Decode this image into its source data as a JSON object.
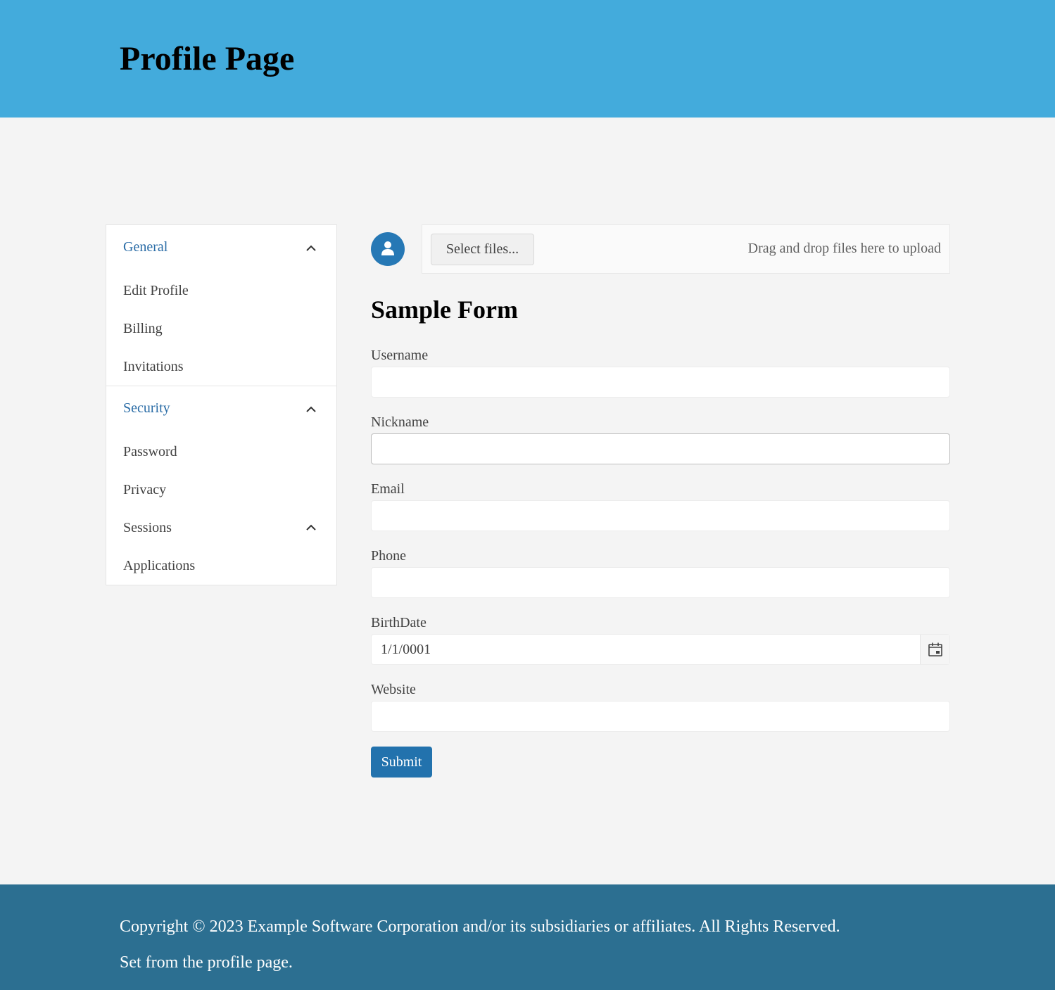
{
  "header": {
    "title": "Profile Page"
  },
  "sidebar": {
    "groups": [
      {
        "label": "General",
        "expanded": true,
        "items": [
          {
            "label": "Edit Profile"
          },
          {
            "label": "Billing"
          },
          {
            "label": "Invitations"
          }
        ]
      },
      {
        "label": "Security",
        "expanded": true,
        "items": [
          {
            "label": "Password"
          },
          {
            "label": "Privacy"
          },
          {
            "label": "Sessions",
            "expandable": true
          },
          {
            "label": "Applications"
          }
        ]
      }
    ]
  },
  "upload": {
    "button_label": "Select files...",
    "hint": "Drag and drop files here to upload",
    "avatar_icon": "user-icon"
  },
  "form": {
    "title": "Sample Form",
    "fields": [
      {
        "label": "Username",
        "value": ""
      },
      {
        "label": "Nickname",
        "value": ""
      },
      {
        "label": "Email",
        "value": ""
      },
      {
        "label": "Phone",
        "value": ""
      },
      {
        "label": "BirthDate",
        "value": "1/1/0001"
      },
      {
        "label": "Website",
        "value": ""
      }
    ],
    "submit_label": "Submit"
  },
  "footer": {
    "copyright": "Copyright © 2023 Example Software Corporation and/or its subsidiaries or affiliates. All Rights Reserved.",
    "note": "Set from the profile page."
  },
  "colors": {
    "header_bg": "#43abdc",
    "footer_bg": "#2c6f91",
    "accent": "#2272ad",
    "link": "#2a6ca6"
  }
}
